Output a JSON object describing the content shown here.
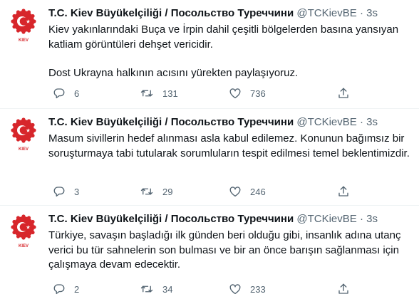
{
  "tweets": [
    {
      "name": "T.C. Kiev Büyükelçiliği / Посольство Туреччини",
      "handle": "@TCKievBE",
      "separator": "·",
      "time": "3s",
      "avatar_label": "KIEV",
      "paragraphs": [
        "Kiev yakınlarındaki Buça ve İrpin dahil çeşitli bölgelerden basına yansıyan katliam görüntüleri dehşet vericidir.",
        "Dost Ukrayna halkının acısını yürekten paylaşıyoruz."
      ],
      "replies": "6",
      "retweets": "131",
      "likes": "736"
    },
    {
      "name": "T.C. Kiev Büyükelçiliği / Посольство Туреччини",
      "handle": "@TCKievBE",
      "separator": "·",
      "time": "3s",
      "avatar_label": "KIEV",
      "paragraphs": [
        "Masum sivillerin hedef alınması asla kabul edilemez. Konunun bağımsız bir soruşturmaya tabi tutularak sorumluların tespit edilmesi temel beklentimizdir."
      ],
      "replies": "3",
      "retweets": "29",
      "likes": "246"
    },
    {
      "name": "T.C. Kiev Büyükelçiliği / Посольство Туреччини",
      "handle": "@TCKievBE",
      "separator": "·",
      "time": "3s",
      "avatar_label": "KIEV",
      "paragraphs": [
        "Türkiye, savaşın başladığı ilk günden beri  olduğu gibi, insanlık adına utanç verici bu tür sahnelerin son bulması ve bir an önce barışın sağlanması için çalışmaya devam edecektir."
      ],
      "replies": "2",
      "retweets": "34",
      "likes": "233"
    }
  ],
  "colors": {
    "emblem_red": "#d7262b",
    "secondary_text": "#536471",
    "primary_text": "#0f1419"
  },
  "icons": {
    "reply": "reply-icon",
    "retweet": "retweet-icon",
    "like": "like-icon",
    "share": "share-icon"
  }
}
